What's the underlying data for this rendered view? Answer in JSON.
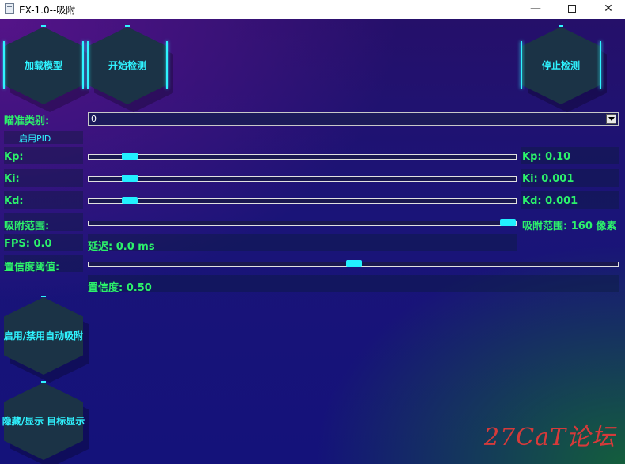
{
  "window": {
    "title": "EX-1.0--吸附",
    "min_glyph": "—",
    "close_glyph": "✕"
  },
  "buttons": {
    "load_model": "加载模型",
    "start_detect": "开始检测",
    "stop_detect": "停止检测",
    "toggle_auto": "启用/禁用自动吸附",
    "toggle_display": "隐藏/显示 目标显示"
  },
  "aim": {
    "label": "瞄准类别:",
    "value": "0"
  },
  "pid_toggle": "启用PID",
  "params": {
    "kp": {
      "label": "Kp:",
      "value_text": "Kp: 0.10",
      "position": 0.08
    },
    "ki": {
      "label": "Ki:",
      "value_text": "Ki: 0.001",
      "position": 0.08
    },
    "kd": {
      "label": "Kd:",
      "value_text": "Kd: 0.001",
      "position": 0.08
    },
    "range": {
      "label": "吸附范围:",
      "value_text": "吸附范围: 160 像素",
      "position": 1.0
    }
  },
  "fps": "FPS: 0.0",
  "latency": "延迟: 0.0 ms",
  "confidence": {
    "label": "置信度阈值:",
    "value_text": "置信度: 0.50",
    "position": 0.5
  },
  "watermark": "27CaT论坛",
  "colors": {
    "accent": "#2ff3ff",
    "value_green": "#2cf26b",
    "hex_fill": "#1b3346"
  }
}
